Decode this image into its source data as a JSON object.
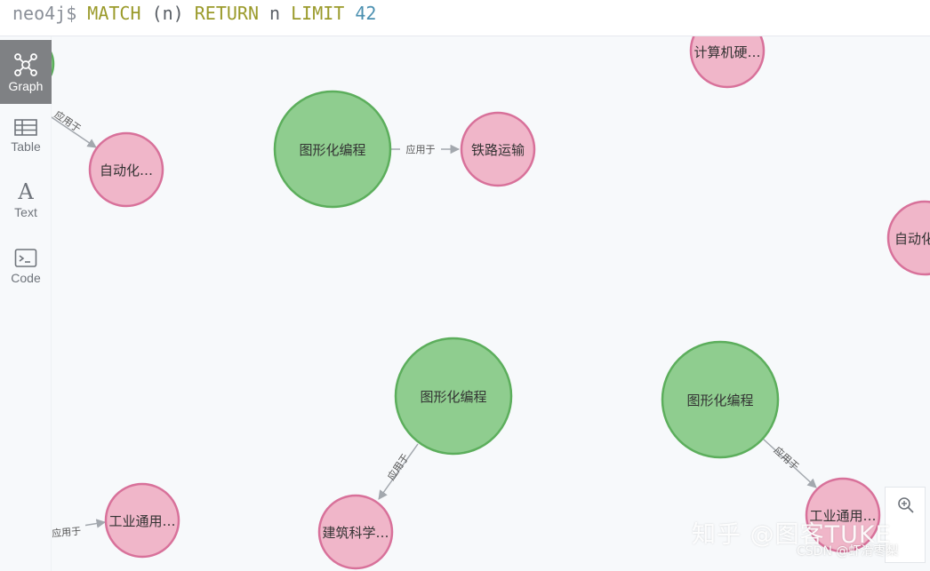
{
  "query": {
    "prompt": "neo4j$",
    "kw_match": "MATCH",
    "arg": "(n)",
    "kw_return": "RETURN",
    "var": "n",
    "kw_limit": "LIMIT",
    "limit": "42"
  },
  "sidebar": {
    "items": [
      {
        "label": "Graph",
        "icon": "graph-icon",
        "active": true
      },
      {
        "label": "Table",
        "icon": "table-icon",
        "active": false
      },
      {
        "label": "Text",
        "icon": "text-icon",
        "active": false
      },
      {
        "label": "Code",
        "icon": "code-icon",
        "active": false
      }
    ]
  },
  "graph": {
    "node_colors": {
      "green": "#8fcd8f",
      "green_stroke": "#5cae5c",
      "pink": "#f0b6c9",
      "pink_stroke": "#d8719a"
    },
    "nodes": [
      {
        "id": "n-partial-left",
        "label": ""
      },
      {
        "id": "n1",
        "label": "自动化…"
      },
      {
        "id": "n2",
        "label": "图形化编程"
      },
      {
        "id": "n3",
        "label": "铁路运输"
      },
      {
        "id": "n4",
        "label": "计算机硬…"
      },
      {
        "id": "n5",
        "label": "自动化"
      },
      {
        "id": "n6",
        "label": "图形化编程"
      },
      {
        "id": "n7",
        "label": "图形化编程"
      },
      {
        "id": "n8",
        "label": "工业通用…"
      },
      {
        "id": "n9",
        "label": "建筑科学…"
      },
      {
        "id": "n10",
        "label": "工业通用…"
      }
    ],
    "edges": [
      {
        "label": "应用于"
      },
      {
        "label": "应用于"
      },
      {
        "label": "应用于"
      },
      {
        "label": "应用于"
      },
      {
        "label": "应用于"
      }
    ]
  },
  "zoom": {
    "icon": "zoom-in-icon"
  },
  "watermark": {
    "main": "知乎 @图客TUKE",
    "sub": "CSDN @虾滑枣梨"
  }
}
